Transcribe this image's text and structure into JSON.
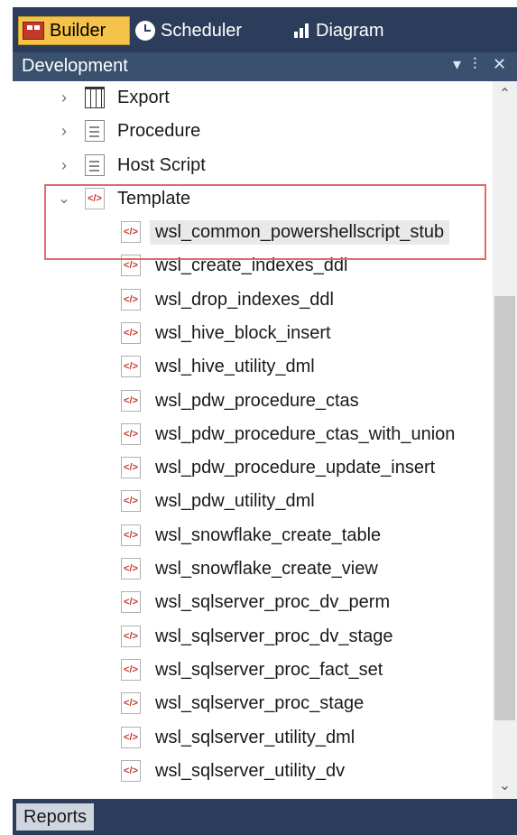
{
  "tabs": [
    {
      "label": "Builder",
      "icon": "builder-icon",
      "active": true
    },
    {
      "label": "Scheduler",
      "icon": "clock-icon",
      "active": false
    },
    {
      "label": "Diagram",
      "icon": "bar-chart-icon",
      "active": false
    }
  ],
  "panel": {
    "title": "Development",
    "controls": {
      "dropdown": "▾",
      "pin": "⫶",
      "close": "✕"
    }
  },
  "tree": {
    "collapsed_nodes": [
      {
        "label": "Export",
        "icon": "export-grid-icon"
      },
      {
        "label": "Procedure",
        "icon": "procedure-doc-icon"
      },
      {
        "label": "Host Script",
        "icon": "host-script-icon"
      }
    ],
    "expanded_node": {
      "label": "Template",
      "icon": "template-icon"
    },
    "selected_item": "wsl_common_powershellscript_stub",
    "template_items": [
      "wsl_common_powershellscript_stub",
      "wsl_create_indexes_ddl",
      "wsl_drop_indexes_ddl",
      "wsl_hive_block_insert",
      "wsl_hive_utility_dml",
      "wsl_pdw_procedure_ctas",
      "wsl_pdw_procedure_ctas_with_union",
      "wsl_pdw_procedure_update_insert",
      "wsl_pdw_utility_dml",
      "wsl_snowflake_create_table",
      "wsl_snowflake_create_view",
      "wsl_sqlserver_proc_dv_perm",
      "wsl_sqlserver_proc_dv_stage",
      "wsl_sqlserver_proc_fact_set",
      "wsl_sqlserver_proc_stage",
      "wsl_sqlserver_utility_dml",
      "wsl_sqlserver_utility_dv"
    ]
  },
  "bottom": {
    "reports_label": "Reports"
  },
  "colors": {
    "tab_bg": "#2b3d5a",
    "active_tab": "#f5c24a",
    "header_bg": "#3a506f",
    "highlight": "#e06b6b"
  }
}
